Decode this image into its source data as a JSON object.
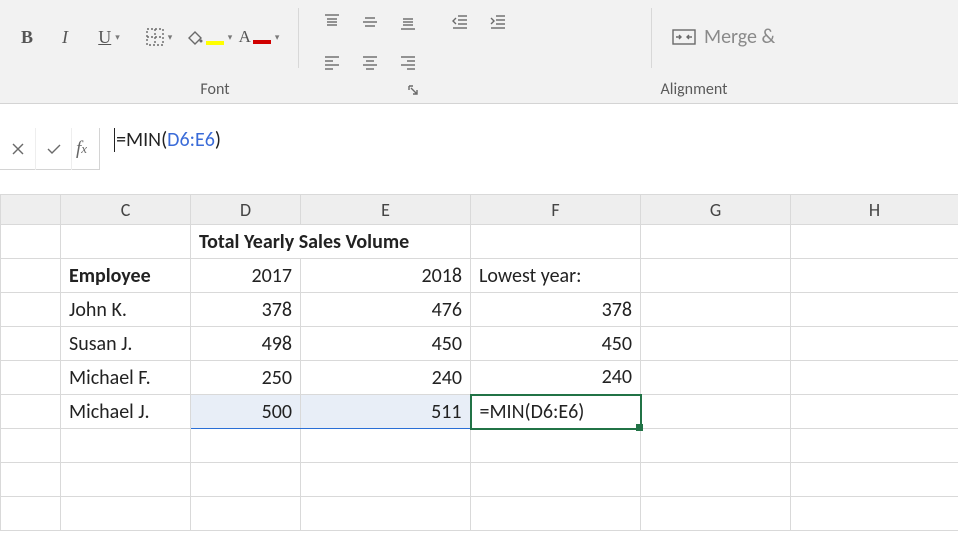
{
  "ribbon": {
    "font_group_label": "Font",
    "align_group_label": "Alignment",
    "bold_label": "B",
    "italic_label": "I",
    "merge_label": "Merge & "
  },
  "formula_bar": {
    "prefix": "=",
    "fn_open": "MIN(",
    "ref": "D6:E6",
    "close": ")"
  },
  "columns": {
    "C": "C",
    "D": "D",
    "E": "E",
    "F": "F",
    "G": "G",
    "H": "H"
  },
  "sheet": {
    "title": "Total Yearly Sales Volume",
    "header_employee": "Employee",
    "header_2017": "2017",
    "header_2018": "2018",
    "header_lowest": "Lowest year:",
    "rows": [
      {
        "name": "John K.",
        "y2017": "378",
        "y2018": "476",
        "lowest": "378"
      },
      {
        "name": "Susan J.",
        "y2017": "498",
        "y2018": "450",
        "lowest": "450"
      },
      {
        "name": "Michael F.",
        "y2017": "250",
        "y2018": "240",
        "lowest": "240"
      },
      {
        "name": "Michael J.",
        "y2017": "500",
        "y2018": "511",
        "lowest": "=MIN(D6:E6)"
      }
    ]
  }
}
